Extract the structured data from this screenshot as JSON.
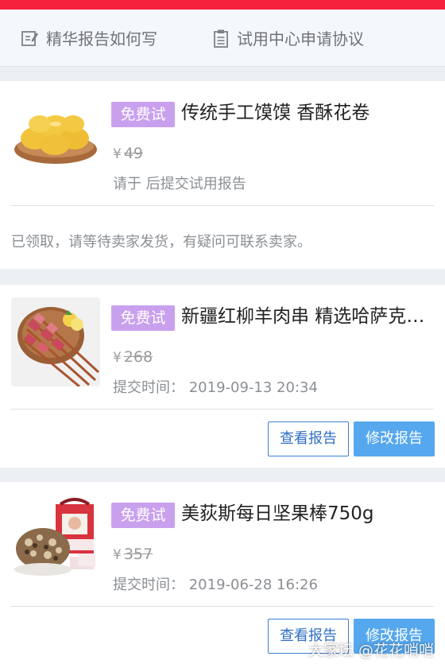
{
  "header": {
    "tab_guide_label": "精华报告如何写",
    "tab_agreement_label": "试用中心申请协议"
  },
  "items": [
    {
      "badge": "免费试",
      "title": "传统手工馍馍 香酥花卷",
      "currency": "¥",
      "price": "49",
      "meta": "请于 后提交试用报告",
      "note": "已领取，请等待卖家发货，有疑问可联系卖家。"
    },
    {
      "badge": "免费试",
      "title": "新疆红柳羊肉串 精选哈萨克羊肉",
      "currency": "¥",
      "price": "268",
      "meta": "提交时间：  2019-09-13 20:34",
      "view_label": "查看报告",
      "edit_label": "修改报告"
    },
    {
      "badge": "免费试",
      "title": "美荻斯每日坚果棒750g",
      "currency": "¥",
      "price": "357",
      "meta": "提交时间：  2019-06-28 16:26",
      "view_label": "查看报告",
      "edit_label": "修改报告"
    }
  ],
  "watermark": "大家坛 @花花哨哨",
  "colors": {
    "top_bar": "#f5213d",
    "badge": "#c9a0ee",
    "primary_button": "#55a7ee",
    "outline_button": "#3a7fd5"
  }
}
